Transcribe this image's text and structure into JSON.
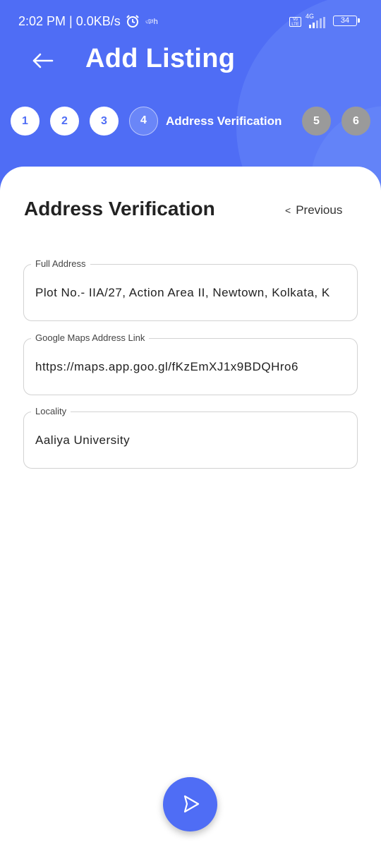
{
  "status_bar": {
    "time": "2:02 PM | 0.0KB/s",
    "bengali_text": "ঞh",
    "volte": "Vo LTE",
    "network": "4G",
    "battery": "34",
    "icons": [
      "alarm-icon",
      "signal-icon",
      "battery-icon"
    ]
  },
  "header": {
    "title": "Add Listing",
    "back_icon": "arrow-left-icon"
  },
  "stepper": {
    "steps": [
      "1",
      "2",
      "3",
      "4",
      "5",
      "6"
    ],
    "current_step": 4,
    "current_label": "Address Verification"
  },
  "form": {
    "section_title": "Address Verification",
    "previous_label": "Previous",
    "previous_icon": "chevron-left-icon",
    "fields": [
      {
        "label": "Full Address",
        "value": "Plot No.- IIA/27, Action Area II, Newtown, Kolkata, K"
      },
      {
        "label": "Google Maps Address Link",
        "value": "https://maps.app.goo.gl/fKzEmXJ1x9BDQHro6"
      },
      {
        "label": "Locality",
        "value": "Aaliya University"
      }
    ]
  },
  "fab": {
    "icon": "play-next-icon"
  },
  "colors": {
    "primary": "#4f6df5",
    "inactive_step": "#9a9a9a",
    "text": "#222222"
  }
}
